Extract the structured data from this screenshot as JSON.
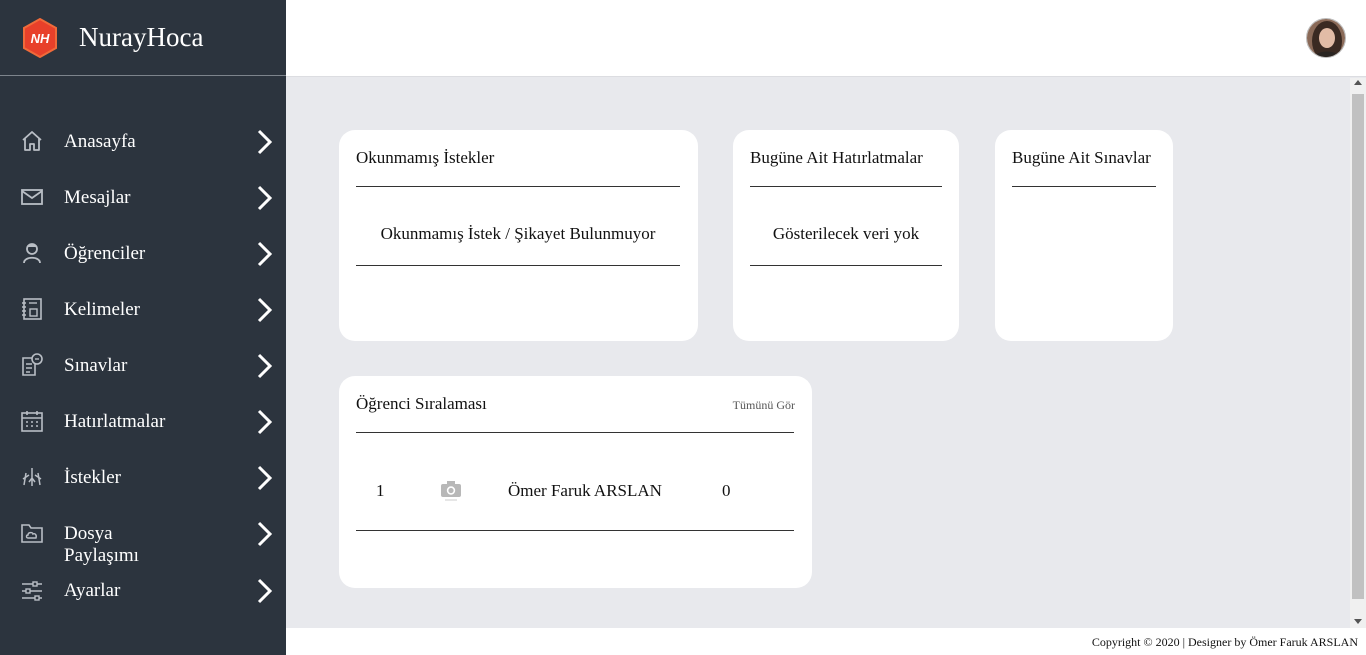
{
  "brand": {
    "logo_text": "NH",
    "name": "NurayHoca",
    "logo_color": "#e8402a"
  },
  "sidebar": {
    "items": [
      {
        "label": "Anasayfa",
        "icon": "home-icon"
      },
      {
        "label": "Mesajlar",
        "icon": "envelope-icon"
      },
      {
        "label": "Öğrenciler",
        "icon": "student-icon"
      },
      {
        "label": "Kelimeler",
        "icon": "vocabulary-book-icon"
      },
      {
        "label": "Sınavlar",
        "icon": "exam-paper-icon"
      },
      {
        "label": "Hatırlatmalar",
        "icon": "calendar-icon"
      },
      {
        "label": "İstekler",
        "icon": "requests-icon"
      },
      {
        "label": "Dosya\nPaylaşımı",
        "icon": "folder-cloud-icon"
      },
      {
        "label": "Ayarlar",
        "icon": "sliders-icon"
      }
    ]
  },
  "cards": {
    "unread_requests": {
      "title": "Okunmamış İstekler",
      "message": "Okunmamış İstek / Şikayet Bulunmuyor"
    },
    "today_reminders": {
      "title": "Bugüne Ait Hatırlatmalar",
      "message": "Gösterilecek veri yok"
    },
    "today_exams": {
      "title": "Bugüne Ait Sınavlar"
    },
    "student_ranking": {
      "title": "Öğrenci Sıralaması",
      "see_all": "Tümünü Gör",
      "rows": [
        {
          "rank": "1",
          "name": "Ömer Faruk ARSLAN",
          "score": "0"
        }
      ]
    }
  },
  "footer": {
    "text": "Copyright © 2020 | Designer by Ömer Faruk ARSLAN"
  },
  "colors": {
    "sidebar_bg": "#2c343e",
    "page_bg": "#e8e9ed",
    "card_bg": "#ffffff"
  }
}
